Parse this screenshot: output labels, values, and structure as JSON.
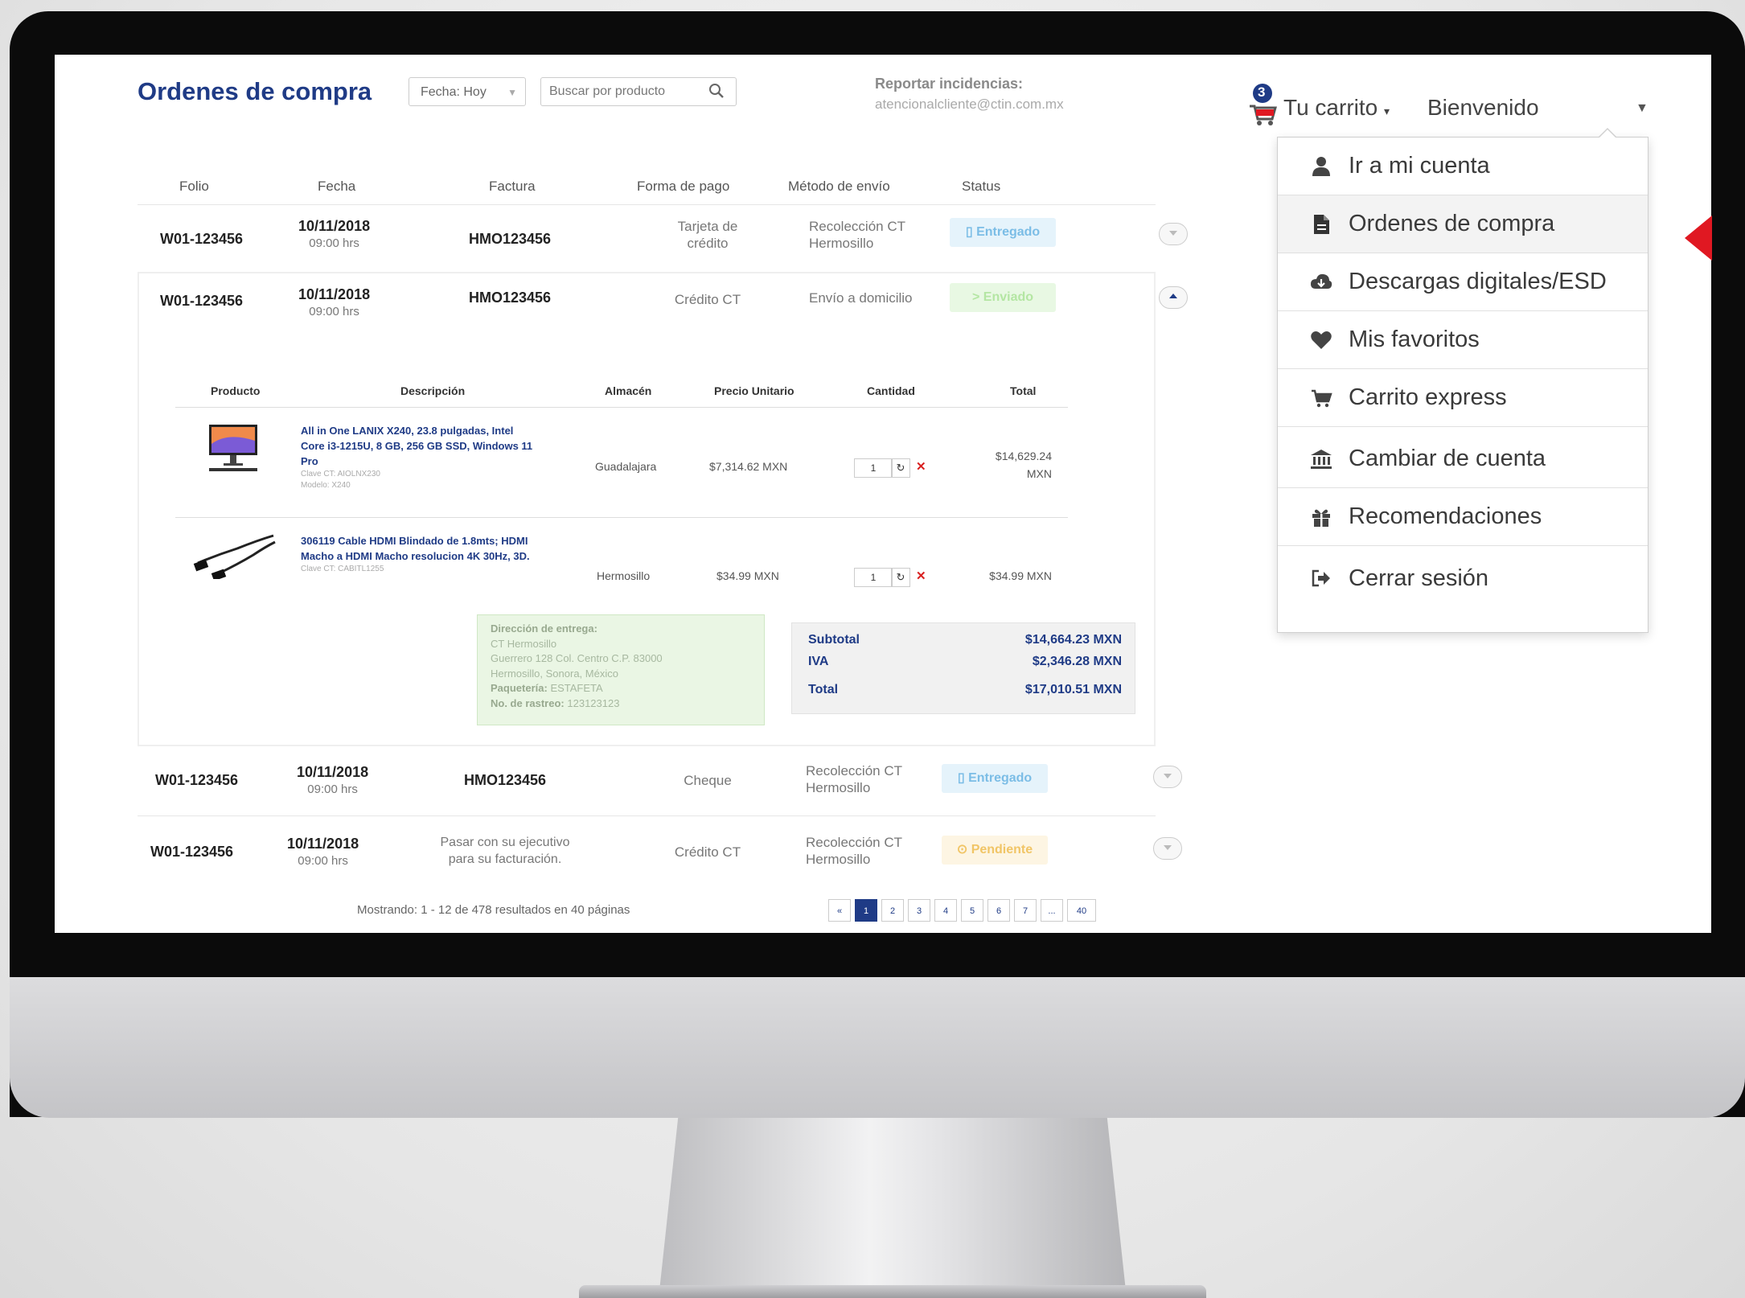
{
  "header": {
    "title": "Ordenes de compra",
    "date_filter": "Fecha: Hoy",
    "search_placeholder": "Buscar por producto",
    "report_title": "Reportar incidencias:",
    "report_email": "atencionalcliente@ctin.com.mx",
    "cart_count": "3",
    "cart_label": "Tu carrito",
    "welcome_label": "Bienvenido"
  },
  "table": {
    "columns": [
      "Folio",
      "Fecha",
      "Factura",
      "Forma de pago",
      "Método de envío",
      "Status"
    ],
    "rows": [
      {
        "folio": "W01-123456",
        "date": "10/11/2018",
        "time": "09:00 hrs",
        "invoice": "HMO123456",
        "payment": "Tarjeta de crédito",
        "shipping": "Recolección CT Hermosillo",
        "status": "Entregado"
      },
      {
        "folio": "W01-123456",
        "date": "10/11/2018",
        "time": "09:00 hrs",
        "invoice": "HMO123456",
        "payment": "Crédito CT",
        "shipping": "Envío a domicilio",
        "status": "Enviado"
      },
      {
        "folio": "W01-123456",
        "date": "10/11/2018",
        "time": "09:00 hrs",
        "invoice": "HMO123456",
        "payment": "Cheque",
        "shipping": "Recolección CT Hermosillo",
        "status": "Entregado"
      },
      {
        "folio": "W01-123456",
        "date": "10/11/2018",
        "time": "09:00 hrs",
        "invoice": "Pasar con su ejecutivo para su facturación.",
        "payment": "Crédito CT",
        "shipping": "Recolección CT Hermosillo",
        "status": "Pendiente"
      }
    ]
  },
  "detail": {
    "columns": [
      "Producto",
      "Descripción",
      "Almacén",
      "Precio Unitario",
      "Cantidad",
      "Total"
    ],
    "items": [
      {
        "name": "All in One LANIX X240, 23.8 pulgadas, Intel Core i3-1215U, 8 GB, 256 GB SSD, Windows 11 Pro",
        "clave": "Clave CT: AIOLNX230",
        "modelo": "Modelo: X240",
        "warehouse": "Guadalajara",
        "unit_price": "$7,314.62 MXN",
        "qty": "1",
        "total": "$14,629.24 MXN"
      },
      {
        "name": "306119 Cable HDMI Blindado de 1.8mts; HDMI Macho a HDMI Macho resolucion 4K 30Hz, 3D.",
        "clave": "Clave CT: CABITL1255",
        "modelo": "",
        "warehouse": "Hermosillo",
        "unit_price": "$34.99 MXN",
        "qty": "1",
        "total": "$34.99 MXN"
      }
    ],
    "address": {
      "label": "Dirección de entrega:",
      "line1": "CT Hermosillo",
      "line2": "Guerrero 128 Col. Centro C.P. 83000",
      "line3": "Hermosillo, Sonora, México",
      "courier_label": "Paquetería:",
      "courier": "ESTAFETA",
      "tracking_label": "No. de rastreo:",
      "tracking": "123123123"
    },
    "totals": {
      "subtotal_label": "Subtotal",
      "subtotal": "$14,664.23 MXN",
      "iva_label": "IVA",
      "iva": "$2,346.28 MXN",
      "total_label": "Total",
      "total": "$17,010.51 MXN"
    }
  },
  "footer": {
    "results": "Mostrando: 1 - 12 de 478 resultados en 40 páginas",
    "pages": [
      "«",
      "1",
      "2",
      "3",
      "4",
      "5",
      "6",
      "7",
      "...",
      "40"
    ],
    "current_page": "1"
  },
  "menu": {
    "items": [
      {
        "label": "Ir a mi cuenta",
        "icon": "user-icon"
      },
      {
        "label": "Ordenes de compra",
        "icon": "document-icon"
      },
      {
        "label": "Descargas digitales/ESD",
        "icon": "cloud-download-icon"
      },
      {
        "label": "Mis favoritos",
        "icon": "heart-icon"
      },
      {
        "label": "Carrito express",
        "icon": "cart-icon"
      },
      {
        "label": "Cambiar de cuenta",
        "icon": "bank-icon"
      },
      {
        "label": "Recomendaciones",
        "icon": "gift-icon"
      },
      {
        "label": "Cerrar sesión",
        "icon": "sign-out-icon"
      }
    ]
  },
  "colors": {
    "brand_blue": "#1f3b86",
    "accent_red": "#e01822"
  }
}
